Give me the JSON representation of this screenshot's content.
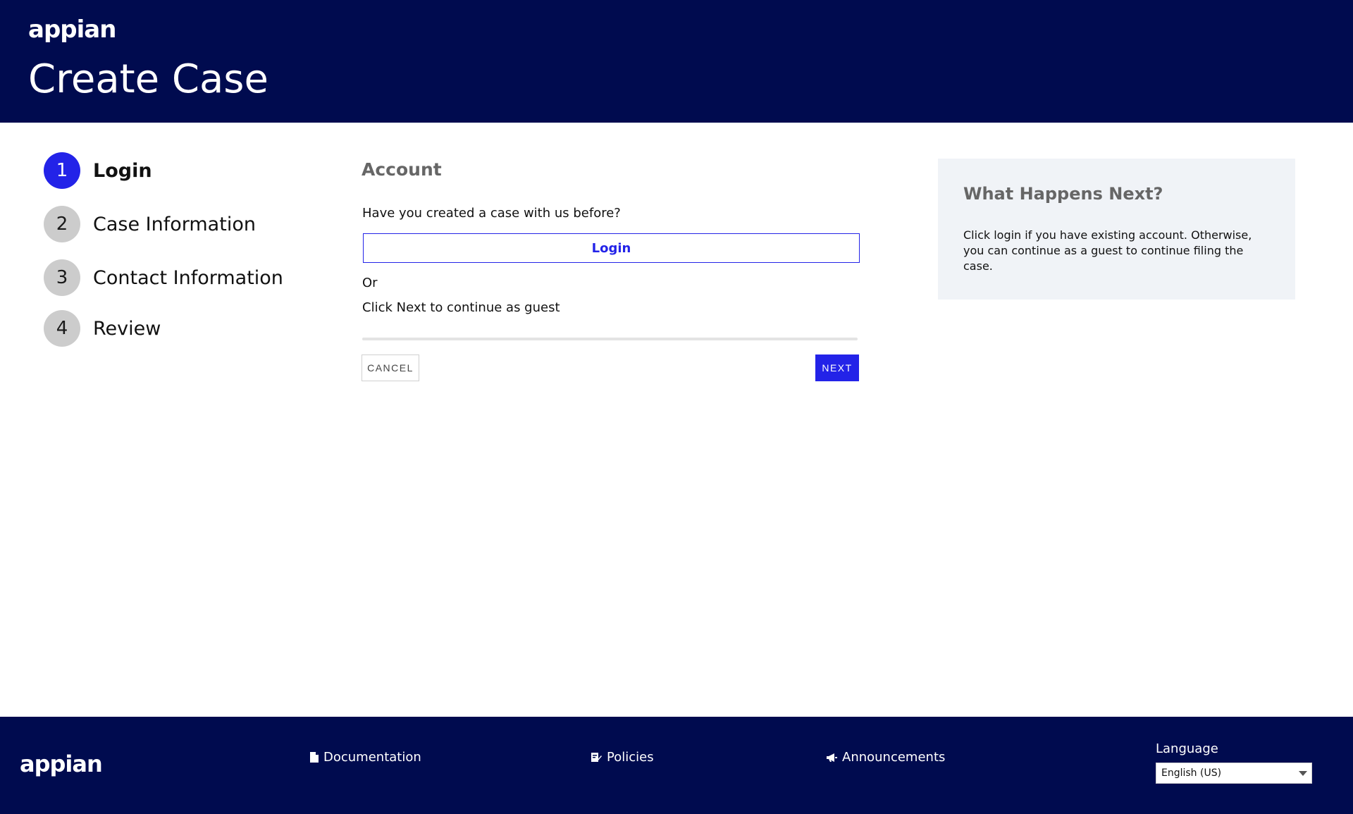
{
  "header": {
    "logo_text": "appian",
    "title": "Create Case"
  },
  "stepper": {
    "steps": [
      {
        "number": "1",
        "label": "Login",
        "active": true
      },
      {
        "number": "2",
        "label": "Case Information",
        "active": false
      },
      {
        "number": "3",
        "label": "Contact Information",
        "active": false
      },
      {
        "number": "4",
        "label": "Review",
        "active": false
      }
    ]
  },
  "main": {
    "section_title": "Account",
    "question": "Have you created a case with us before?",
    "login_button": "Login",
    "or_text": "Or",
    "guest_text": "Click Next to continue as guest",
    "cancel_button": "CANCEL",
    "next_button": "NEXT"
  },
  "info_panel": {
    "title": "What Happens Next?",
    "text": "Click login if you have existing account. Otherwise, you can continue as a guest to continue filing the case."
  },
  "footer": {
    "logo_text": "appian",
    "links": [
      {
        "label": "Documentation",
        "icon": "document-icon"
      },
      {
        "label": "Policies",
        "icon": "policy-icon"
      },
      {
        "label": "Announcements",
        "icon": "megaphone-icon"
      }
    ],
    "language_label": "Language",
    "language_selected": "English (US)"
  },
  "colors": {
    "header_bg": "#000b4f",
    "accent": "#2323e8",
    "panel_bg": "#f0f3f7"
  }
}
